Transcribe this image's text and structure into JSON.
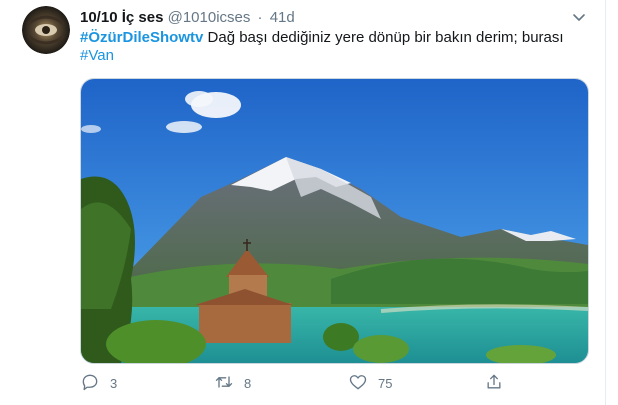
{
  "tweet": {
    "name": "10/10 İç ses",
    "handle": "@1010icses",
    "separator": "·",
    "time": "41d",
    "hashtag1": "#ÖzürDileShowtv",
    "text": " Dağ başı dediğiniz yere dönüp bir bakın derim; burası",
    "hashtag2": "#Van"
  },
  "actions": {
    "reply_count": "3",
    "retweet_count": "8",
    "like_count": "75"
  },
  "colors": {
    "link": "#1b95e0",
    "muted": "#657786",
    "text": "#14171a"
  },
  "icons": [
    "avatar-image",
    "chevron-down-icon",
    "reply-icon",
    "retweet-icon",
    "like-icon",
    "share-icon"
  ]
}
